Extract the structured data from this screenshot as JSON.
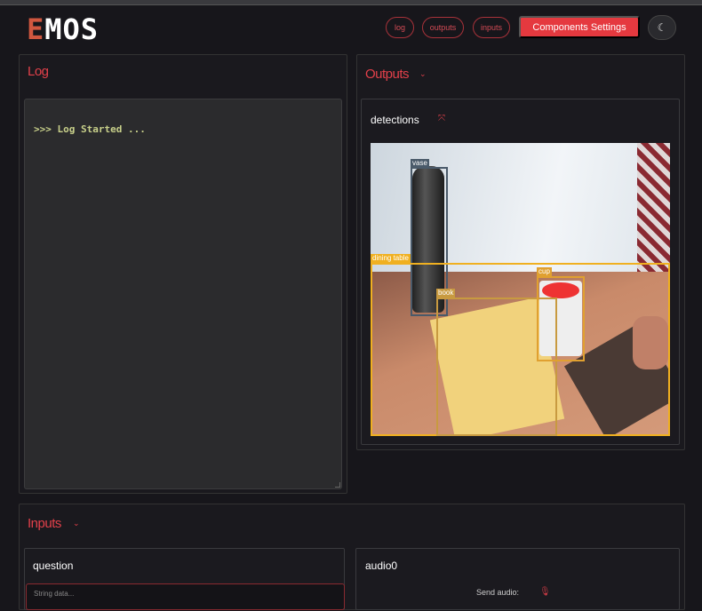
{
  "header": {
    "logo_first": "E",
    "logo_rest": "MOS",
    "nav": [
      "log",
      "outputs",
      "inputs"
    ],
    "settings_label": "Components Settings",
    "theme_icon": "moon-icon"
  },
  "log": {
    "title": "Log",
    "text": ">>> Log Started ..."
  },
  "outputs": {
    "title": "Outputs",
    "card_title": "detections",
    "detections": [
      {
        "label": "vase",
        "color": "#4a5a6a"
      },
      {
        "label": "dining table",
        "color": "#f0b020"
      },
      {
        "label": "book",
        "color": "#c89a40"
      },
      {
        "label": "cup",
        "color": "#e0a030"
      }
    ]
  },
  "inputs": {
    "title": "Inputs",
    "question": {
      "title": "question",
      "placeholder": "String data..."
    },
    "audio": {
      "title": "audio0",
      "send_label": "Send audio:"
    }
  },
  "colors": {
    "accent": "#e5393f"
  }
}
